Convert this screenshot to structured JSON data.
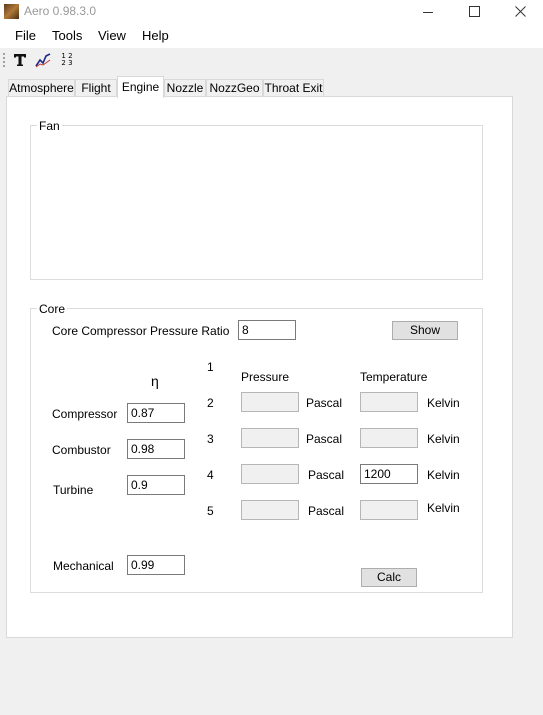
{
  "window": {
    "title": "Aero 0.98.3.0"
  },
  "menu": {
    "file": "File",
    "tools": "Tools",
    "view": "View",
    "help": "Help"
  },
  "toolbar": {
    "numbers_top": "1 2",
    "numbers_bottom": "2 3"
  },
  "tabs": [
    "Atmosphere",
    "Flight",
    "Engine",
    "Nozzle",
    "NozzGeo",
    "Throat Exit"
  ],
  "active_tab": "Engine",
  "fan": {
    "title": "Fan"
  },
  "core": {
    "title": "Core",
    "cpr_label": "Core Compressor Pressure Ratio",
    "cpr_value": "8",
    "show_button": "Show",
    "eta_symbol": "η",
    "efficiencies": {
      "compressor_label": "Compressor",
      "compressor_value": "0.87",
      "combustor_label": "Combustor",
      "combustor_value": "0.98",
      "turbine_label": "Turbine",
      "turbine_value": "0.9",
      "mechanical_label": "Mechanical",
      "mechanical_value": "0.99"
    },
    "pressure_header": "Pressure",
    "temperature_header": "Temperature",
    "pressure_unit": "Pascal",
    "temperature_unit": "Kelvin",
    "stations": [
      {
        "number": "1"
      },
      {
        "number": "2",
        "pressure": "",
        "temperature": ""
      },
      {
        "number": "3",
        "pressure": "",
        "temperature": ""
      },
      {
        "number": "4",
        "pressure": "",
        "temperature": "1200"
      },
      {
        "number": "5",
        "pressure": "",
        "temperature": ""
      }
    ],
    "calc_button": "Calc"
  },
  "colors": {
    "window_bg": "#f0f0f0",
    "panel_bg": "#ffffff",
    "readonly_bg": "#f0f0f0"
  }
}
